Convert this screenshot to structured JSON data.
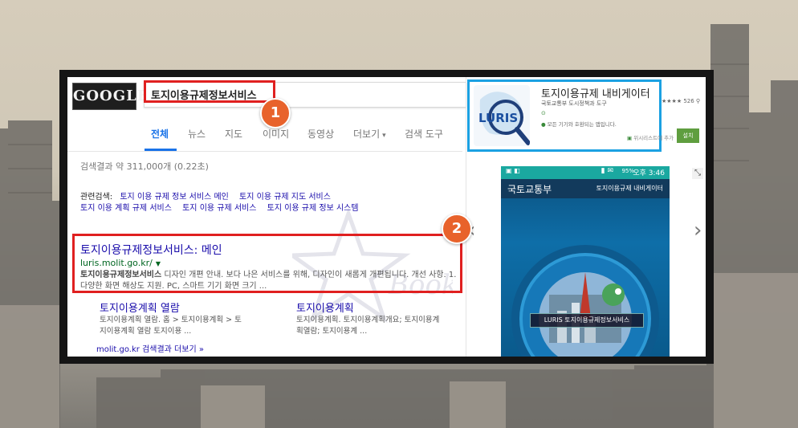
{
  "search": {
    "logo": "GOOGLE",
    "query": "토지이용규제정보서비스",
    "tabs": [
      {
        "label": "전체"
      },
      {
        "label": "뉴스"
      },
      {
        "label": "지도"
      },
      {
        "label": "이미지"
      },
      {
        "label": "동영상"
      },
      {
        "label": "더보기"
      },
      {
        "label": "검색 도구"
      }
    ],
    "more_caret": "▾",
    "result_stats": "검색결과 약 311,000개 (0.22초)",
    "related_label": "관련검색:",
    "related": [
      "토지 이용 규제 정보 서비스 메인",
      "토지 이용 규제 지도 서비스",
      "토지 이용 계획 규제 서비스",
      "토지 이용 규제 서비스",
      "토지 이용 규제 정보 시스템"
    ],
    "result": {
      "title": "토지이용규제정보서비스: 메인",
      "url": "luris.molit.go.kr/",
      "snippet_bold": "토지이용규제정보서비스",
      "snippet": " 디자인 개편 안내. 보다 나은 서비스를 위해, 디자인이 새롭게 개편됩니다. 개선 사항. 1. 다양한 화면 해상도 지원. PC, 스마트 기기 화면 크기 ..."
    },
    "sublinks": [
      {
        "title": "토지이용계획 열람",
        "desc": "토지이용계획 열람. 홈 > 토지이용계획 > 토지이용계획 열람 토지이용 ..."
      },
      {
        "title": "토지이용계획",
        "desc": "토지이용계획. 토지이용계획개요; 토지이용계획열람; 토지이용계 ..."
      }
    ],
    "more_results": "molit.go.kr 검색결과 더보기 »"
  },
  "badges": [
    "1",
    "2"
  ],
  "app": {
    "title": "토지이용규제 내비게이터",
    "icon_text": "LURIS",
    "developer": "국토교통부 도시정책과  도구",
    "rating_text": "★★★★ 526 ⚲",
    "compat": "모든 기기와 호환되는 앱입니다.",
    "wishlist": "위시리스트에 추가",
    "install": "설치",
    "phone": {
      "status_time": "오후 3:46",
      "battery": "95%",
      "header_left": "국토교통부",
      "header_right": "토지이용규제 내비게이터",
      "badge": "LURIS 토지이용규제정보서비스"
    }
  },
  "watermark": "Book",
  "colors": {
    "highlight_red": "#e02020",
    "highlight_blue": "#1ba1e2",
    "badge_orange": "#e8622b",
    "link_blue": "#1a0dab",
    "url_green": "#006621",
    "tab_active": "#1a73e8"
  },
  "icons": [
    "expand-icon",
    "chevron-left-icon",
    "chevron-right-icon",
    "info-dot-icon",
    "star-icon"
  ]
}
